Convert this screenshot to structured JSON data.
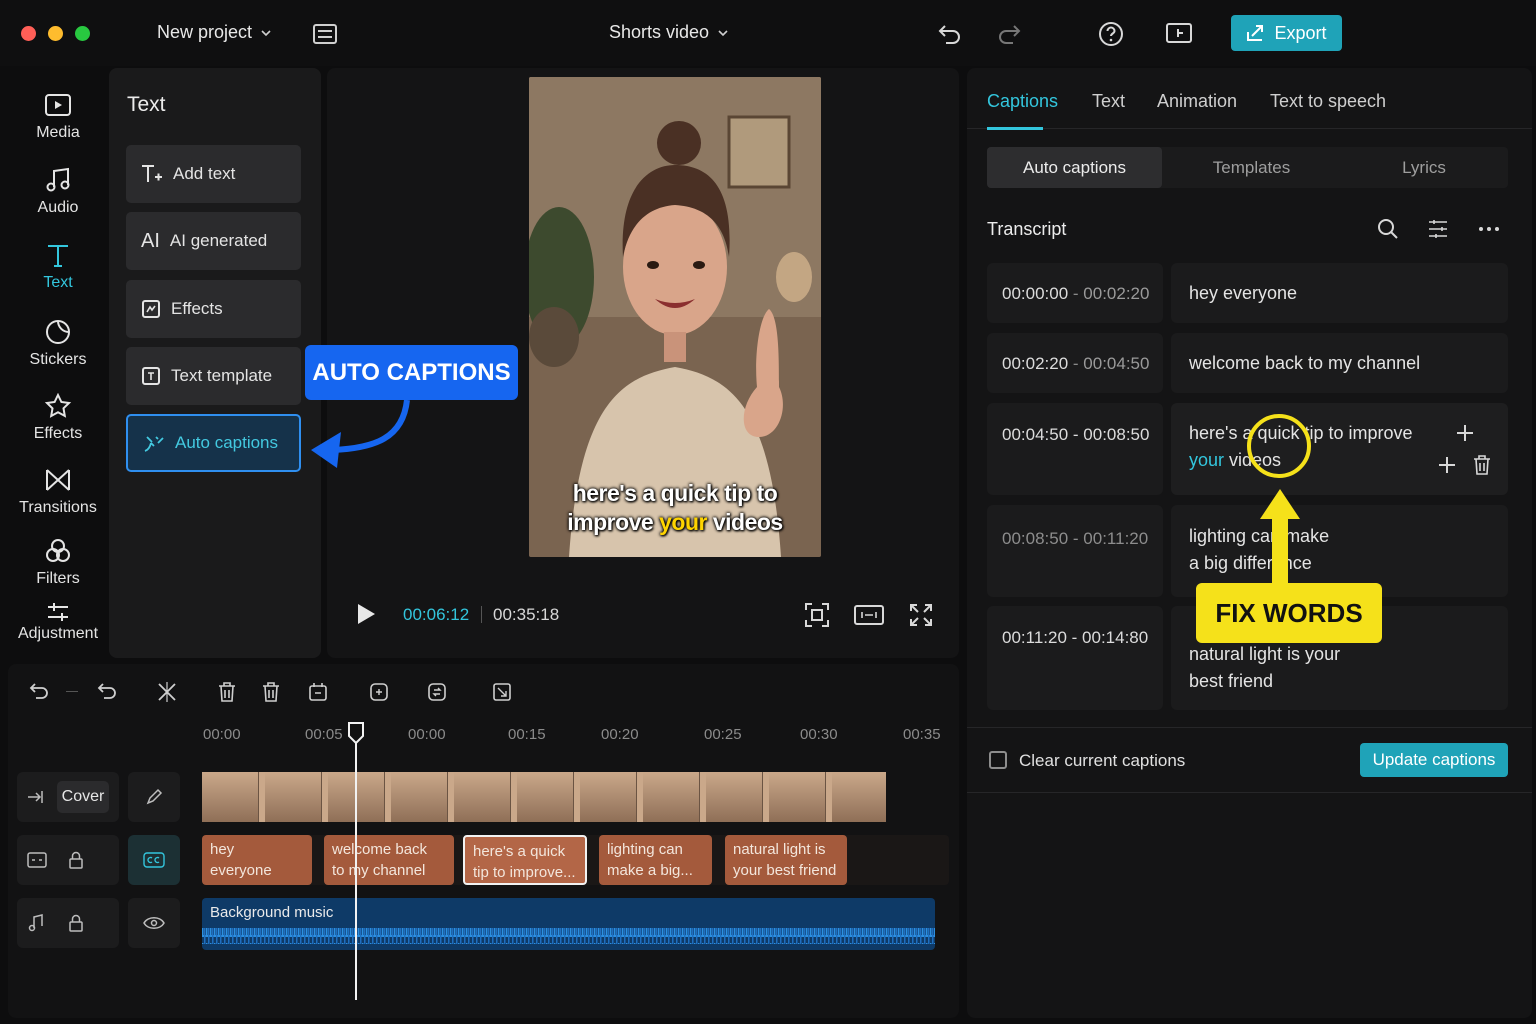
{
  "window": {
    "project_menu": "New project",
    "video_menu": "Shorts video",
    "export_label": "Export"
  },
  "rail": [
    {
      "label": "Media"
    },
    {
      "label": "Audio"
    },
    {
      "label": "Text"
    },
    {
      "label": "Stickers"
    },
    {
      "label": "Effects"
    },
    {
      "label": "Transitions"
    },
    {
      "label": "Filters"
    },
    {
      "label": "Adjustment"
    }
  ],
  "text_panel": {
    "title": "Text",
    "buttons": [
      "Add text",
      "AI generated",
      "Effects",
      "Text template",
      "Auto captions"
    ]
  },
  "preview": {
    "caption_line1": "here's a quick tip to",
    "caption_line2_a": "improve ",
    "caption_line2_b": "your",
    "caption_line2_c": " videos",
    "current_time": "00:06:12",
    "total_time": "00:35:18"
  },
  "annotations": {
    "auto_captions": "AUTO CAPTIONS",
    "fix_words": "FIX WORDS"
  },
  "right_panel": {
    "tabs": [
      "Captions",
      "Text",
      "Animation",
      "Text to speech"
    ],
    "segments": [
      "Auto captions",
      "Templates",
      "Lyrics"
    ],
    "transcript_label": "Transcript",
    "rows": [
      {
        "start": "00:00:00",
        "end": "00:02:20",
        "line1": "hey everyone",
        "line2": ""
      },
      {
        "start": "00:02:20",
        "end": "00:04:50",
        "line1": "welcome back to my channel",
        "line2": ""
      },
      {
        "start": "00:04:50",
        "end": "00:08:50",
        "line1": "here's a quick tip to improve",
        "line2a": "your",
        "line2b": " videos"
      },
      {
        "start": "00:08:50",
        "end": "00:11:20",
        "line1": "lighting can make",
        "line2": "a big difference"
      },
      {
        "start": "00:11:20",
        "end": "00:14:80",
        "line1": "natural light is your",
        "line2": "best friend"
      }
    ],
    "clear_label": "Clear current captions",
    "update_label": "Update captions"
  },
  "timeline": {
    "ticks": [
      "00:00",
      "00:05",
      "00:00",
      "00:15",
      "00:20",
      "00:25",
      "00:30",
      "00:35"
    ],
    "cover_label": "Cover",
    "caption_clips": [
      {
        "l1": "hey",
        "l2": "everyone"
      },
      {
        "l1": "welcome back",
        "l2": "to my channel"
      },
      {
        "l1": "here's a quick",
        "l2": "tip to improve..."
      },
      {
        "l1": "lighting can",
        "l2": "make a big..."
      },
      {
        "l1": "natural light is",
        "l2": "your best friend"
      }
    ],
    "music_label": "Background music"
  },
  "colors": {
    "accent": "#33c6dd",
    "export": "#1fa3b8",
    "annotation_blue": "#1666f0",
    "annotation_yellow": "#f5e11a",
    "caption_clip": "#a45a3c"
  }
}
